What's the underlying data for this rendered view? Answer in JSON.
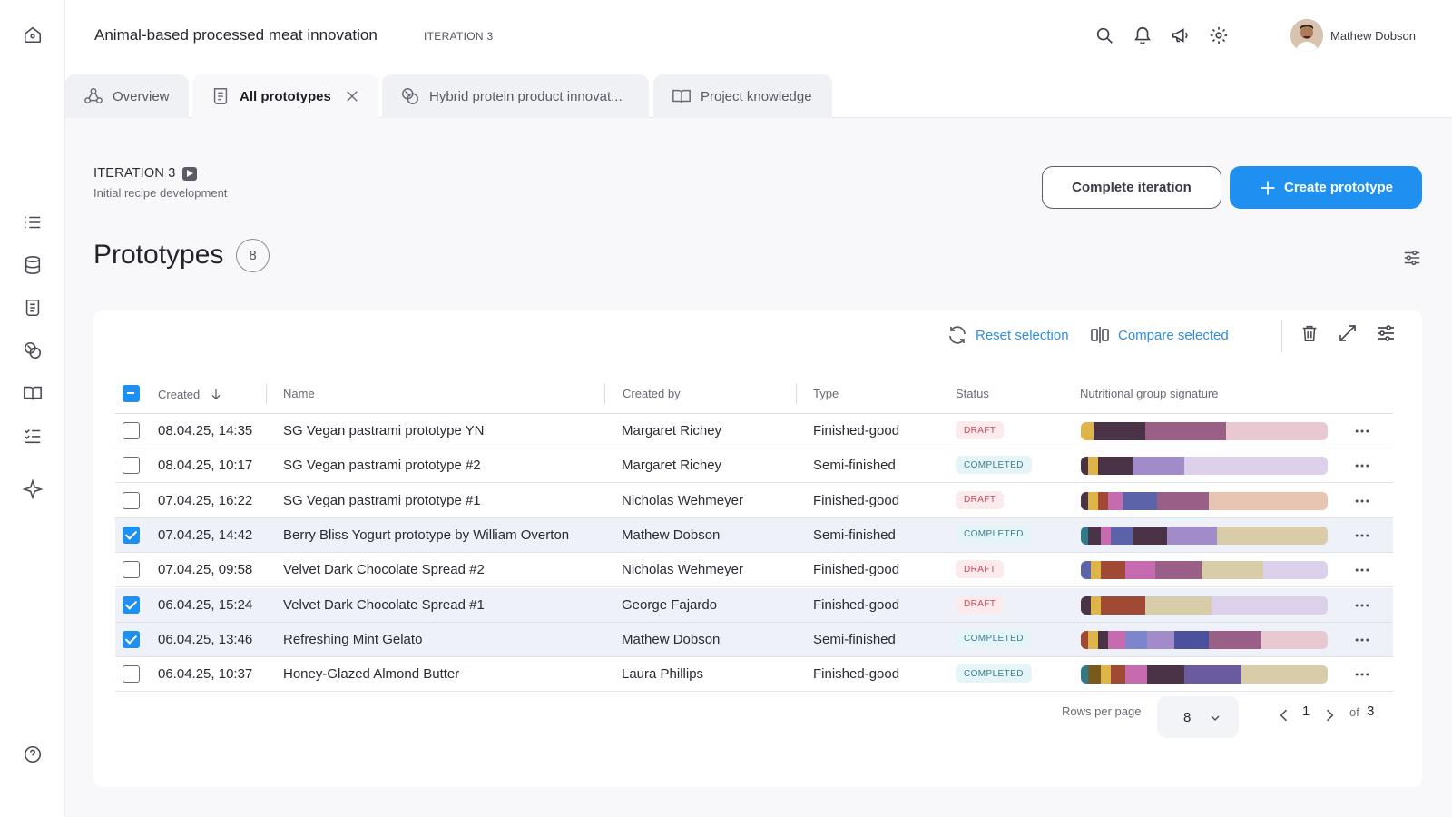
{
  "project": {
    "title": "Animal-based processed meat innovation",
    "iteration_label": "ITERATION 3"
  },
  "user": {
    "name": "Mathew Dobson"
  },
  "tabs": [
    {
      "label": "Overview",
      "active": false
    },
    {
      "label": "All prototypes",
      "active": true
    },
    {
      "label": "Hybrid protein product innovat...",
      "active": false
    },
    {
      "label": "Project knowledge",
      "active": false
    }
  ],
  "iteration": {
    "title": "ITERATION 3",
    "subtitle": "Initial recipe development"
  },
  "actions": {
    "complete": "Complete iteration",
    "create": "Create prototype"
  },
  "prototypes": {
    "title": "Prototypes",
    "count": "8"
  },
  "toolbar": {
    "reset": "Reset selection",
    "compare": "Compare selected"
  },
  "columns": {
    "created": "Created",
    "name": "Name",
    "created_by": "Created by",
    "type": "Type",
    "status": "Status",
    "signature": "Nutritional group signature"
  },
  "rows": [
    {
      "created": "08.04.25, 14:35",
      "name": "SG Vegan pastrami prototype YN",
      "created_by": "Margaret Richey",
      "type": "Finished-good",
      "status": "DRAFT",
      "selected": false,
      "signature": [
        [
          "#e0b548",
          0.05
        ],
        [
          "#4a3347",
          0.21
        ],
        [
          "#9a5f86",
          0.33
        ],
        [
          "#e9c9d1",
          0.41
        ]
      ]
    },
    {
      "created": "08.04.25, 10:17",
      "name": "SG Vegan pastrami prototype #2",
      "created_by": "Margaret Richey",
      "type": "Semi-finished",
      "status": "COMPLETED",
      "selected": false,
      "signature": [
        [
          "#4a3347",
          0.03
        ],
        [
          "#e0b548",
          0.04
        ],
        [
          "#4a3347",
          0.14
        ],
        [
          "#a18bc8",
          0.21
        ],
        [
          "#ddd0ea",
          0.58
        ]
      ]
    },
    {
      "created": "07.04.25, 16:22",
      "name": "SG Vegan pastrami prototype #1",
      "created_by": "Nicholas Wehmeyer",
      "type": "Finished-good",
      "status": "DRAFT",
      "selected": false,
      "signature": [
        [
          "#4a3347",
          0.03
        ],
        [
          "#e0b548",
          0.04
        ],
        [
          "#a04a35",
          0.04
        ],
        [
          "#c76bb0",
          0.06
        ],
        [
          "#5c63a8",
          0.14
        ],
        [
          "#9a5f86",
          0.21
        ],
        [
          "#e8c5b2",
          0.48
        ]
      ]
    },
    {
      "created": "07.04.25, 14:42",
      "name": "Berry Bliss Yogurt prototype by William Overton",
      "created_by": "Mathew Dobson",
      "type": "Semi-finished",
      "status": "COMPLETED",
      "selected": true,
      "signature": [
        [
          "#2e7a8a",
          0.03
        ],
        [
          "#4a3347",
          0.05
        ],
        [
          "#c76bb0",
          0.04
        ],
        [
          "#5c63a8",
          0.09
        ],
        [
          "#4a3347",
          0.14
        ],
        [
          "#a18bc8",
          0.2
        ],
        [
          "#d8cca9",
          0.45
        ]
      ]
    },
    {
      "created": "07.04.25, 09:58",
      "name": "Velvet Dark Chocolate Spread #2",
      "created_by": "Nicholas Wehmeyer",
      "type": "Finished-good",
      "status": "DRAFT",
      "selected": false,
      "signature": [
        [
          "#5c63a8",
          0.04
        ],
        [
          "#e0b548",
          0.04
        ],
        [
          "#a04a35",
          0.1
        ],
        [
          "#c76bb0",
          0.12
        ],
        [
          "#9a5f86",
          0.19
        ],
        [
          "#d8cca9",
          0.25
        ],
        [
          "#ddd0ea",
          0.26
        ]
      ]
    },
    {
      "created": "06.04.25, 15:24",
      "name": "Velvet Dark Chocolate Spread #1",
      "created_by": "George Fajardo",
      "type": "Finished-good",
      "status": "DRAFT",
      "selected": true,
      "signature": [
        [
          "#4a3347",
          0.04
        ],
        [
          "#e0b548",
          0.04
        ],
        [
          "#a04a35",
          0.18
        ],
        [
          "#d8cca9",
          0.27
        ],
        [
          "#ddd0ea",
          0.47
        ]
      ]
    },
    {
      "created": "06.04.25, 13:46",
      "name": "Refreshing Mint Gelato",
      "created_by": "Mathew Dobson",
      "type": "Semi-finished",
      "status": "COMPLETED",
      "selected": true,
      "signature": [
        [
          "#a04a35",
          0.03
        ],
        [
          "#e0b548",
          0.04
        ],
        [
          "#4a3347",
          0.04
        ],
        [
          "#c76bb0",
          0.07
        ],
        [
          "#7d86cc",
          0.09
        ],
        [
          "#a18bc8",
          0.11
        ],
        [
          "#4c519e",
          0.14
        ],
        [
          "#9a5f86",
          0.21
        ],
        [
          "#e9c9d1",
          0.27
        ]
      ]
    },
    {
      "created": "06.04.25, 10:37",
      "name": "Honey-Glazed Almond Butter",
      "created_by": "Laura Phillips",
      "type": "Finished-good",
      "status": "COMPLETED",
      "selected": false,
      "signature": [
        [
          "#2e7a8a",
          0.03
        ],
        [
          "#7a5a1a",
          0.05
        ],
        [
          "#e0b548",
          0.04
        ],
        [
          "#a04a35",
          0.06
        ],
        [
          "#c76bb0",
          0.09
        ],
        [
          "#4a3347",
          0.15
        ],
        [
          "#6a5aa0",
          0.23
        ],
        [
          "#d8cca9",
          0.35
        ]
      ]
    }
  ],
  "pagination": {
    "rows_label": "Rows per page",
    "rows_value": "8",
    "page": "1",
    "of_label": "of",
    "total": "3"
  },
  "colors": {
    "accent": "#1f8ff0",
    "draft_bg": "#fcebed",
    "draft_text": "#c6485a",
    "completed_bg": "#e5f4f6",
    "completed_text": "#3b7f93",
    "selected_row": "#eef1f8"
  },
  "icons": [
    "home-icon",
    "list-icon",
    "database-icon",
    "prototype-icon",
    "ingredients-icon",
    "book-icon",
    "checklist-icon",
    "sparkle-icon",
    "help-icon",
    "search-icon",
    "bell-icon",
    "megaphone-icon",
    "gear-icon"
  ]
}
